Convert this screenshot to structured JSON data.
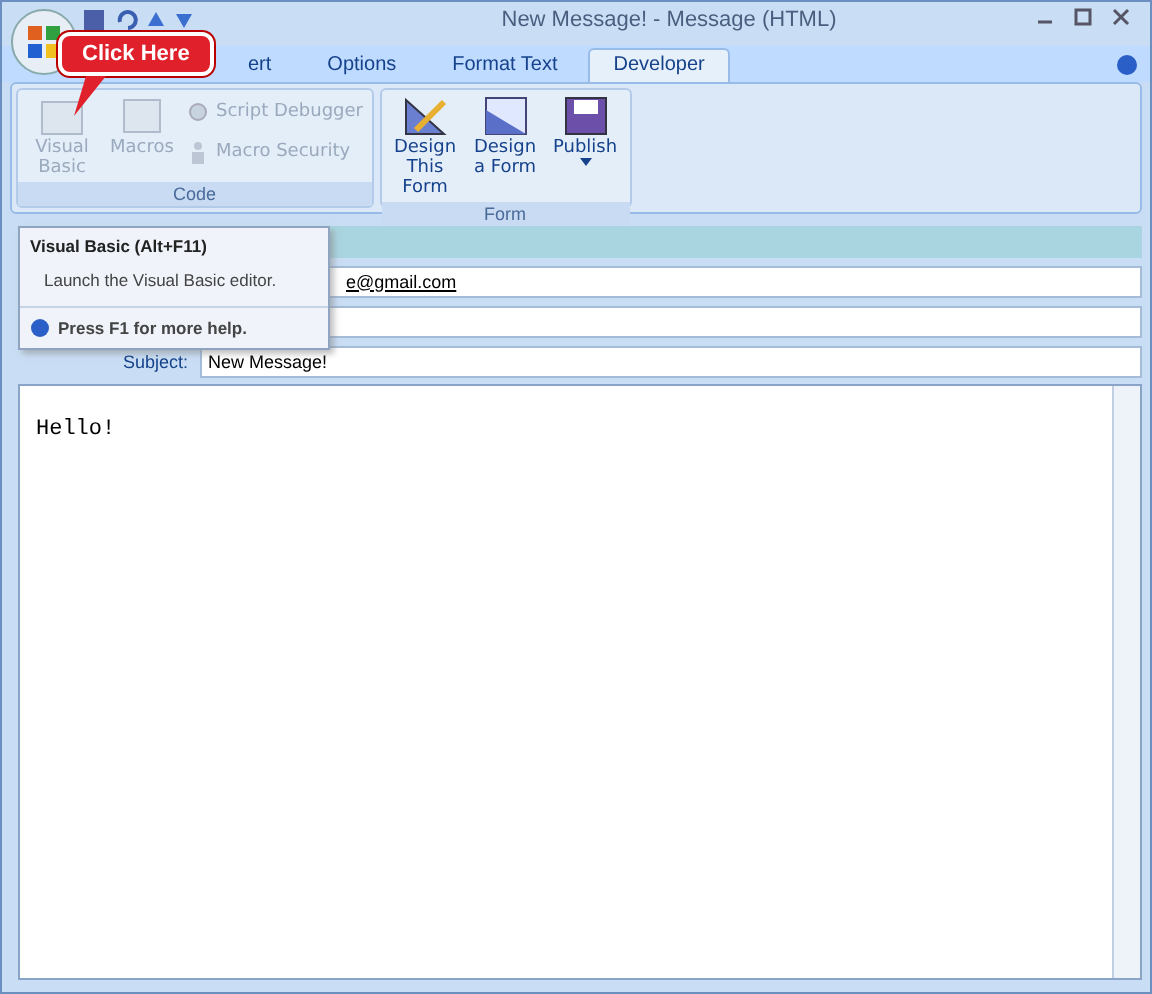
{
  "window": {
    "title": "New Message! - Message (HTML)"
  },
  "callout": {
    "text": "Click Here"
  },
  "tabs": [
    {
      "label": "ert",
      "selected": false
    },
    {
      "label": "Options",
      "selected": false
    },
    {
      "label": "Format Text",
      "selected": false
    },
    {
      "label": "Developer",
      "selected": true
    }
  ],
  "ribbon_groups": [
    {
      "label": "Code",
      "buttons": [
        {
          "label": "Visual Basic",
          "kind": "large",
          "disabled": true
        },
        {
          "label": "Macros",
          "kind": "large",
          "disabled": true
        },
        {
          "label": "Script Debugger",
          "kind": "small",
          "disabled": true
        },
        {
          "label": "Macro Security",
          "kind": "small",
          "disabled": true
        }
      ]
    },
    {
      "label": "Form",
      "buttons": [
        {
          "label": "Design This Form",
          "kind": "large",
          "disabled": false
        },
        {
          "label": "Design a Form",
          "kind": "large",
          "disabled": false
        },
        {
          "label": "Publish",
          "kind": "large",
          "disabled": false,
          "dropdown": true
        }
      ]
    }
  ],
  "tooltip": {
    "title": "Visual Basic (Alt+F11)",
    "description": "Launch the Visual Basic editor.",
    "help": "Press F1 for more help."
  },
  "header": {
    "to_value": "e@gmail.com",
    "subject_label": "Subject:",
    "subject_value": "New Message!"
  },
  "body": {
    "text": "Hello!"
  }
}
